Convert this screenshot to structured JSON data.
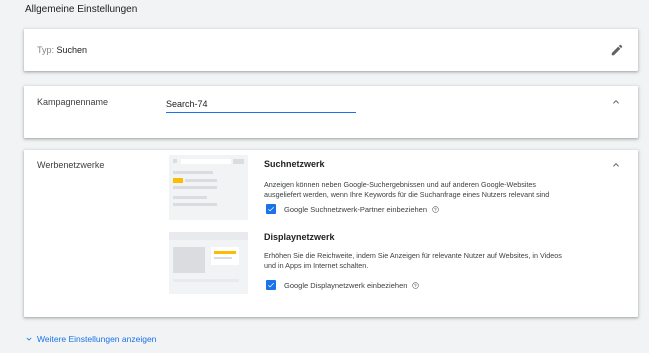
{
  "section": {
    "title": "Allgemeine Einstellungen"
  },
  "type_card": {
    "label": "Typ:",
    "value": "Suchen",
    "edit_icon": "pencil-icon"
  },
  "name_card": {
    "label": "Kampagnenname",
    "value": "Search-74"
  },
  "networks_card": {
    "label": "Werbenetzwerke",
    "search": {
      "title": "Suchnetzwerk",
      "description_line1": "Anzeigen können neben Google-Suchergebnissen und auf anderen Google-Websites",
      "description_line2": "ausgeliefert werden, wenn Ihre Keywords für die Suchanfrage eines Nutzers relevant sind",
      "checkbox_label": "Google Suchnetzwerk-Partner einbeziehen",
      "checked": true
    },
    "display": {
      "title": "Displaynetzwerk",
      "description_line1": "Erhöhen Sie die Reichweite, indem Sie Anzeigen für relevante Nutzer auf Websites, in Videos",
      "description_line2": "und in Apps im Internet schalten.",
      "checkbox_label": "Google Displaynetzwerk einbeziehen",
      "checked": true
    }
  },
  "more_settings": {
    "label": "Weitere Einstellungen anzeigen"
  },
  "colors": {
    "accent": "#1a73e8",
    "background": "#f1f3f4",
    "highlight": "#fbbc04"
  }
}
